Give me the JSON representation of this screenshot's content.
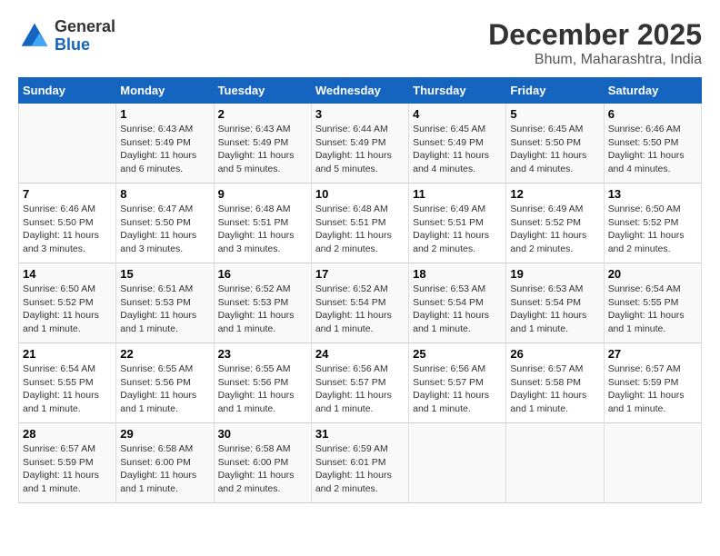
{
  "logo": {
    "line1": "General",
    "line2": "Blue"
  },
  "title": "December 2025",
  "location": "Bhum, Maharashtra, India",
  "days_header": [
    "Sunday",
    "Monday",
    "Tuesday",
    "Wednesday",
    "Thursday",
    "Friday",
    "Saturday"
  ],
  "weeks": [
    [
      {
        "day": "",
        "info": ""
      },
      {
        "day": "1",
        "info": "Sunrise: 6:43 AM\nSunset: 5:49 PM\nDaylight: 11 hours\nand 6 minutes."
      },
      {
        "day": "2",
        "info": "Sunrise: 6:43 AM\nSunset: 5:49 PM\nDaylight: 11 hours\nand 5 minutes."
      },
      {
        "day": "3",
        "info": "Sunrise: 6:44 AM\nSunset: 5:49 PM\nDaylight: 11 hours\nand 5 minutes."
      },
      {
        "day": "4",
        "info": "Sunrise: 6:45 AM\nSunset: 5:49 PM\nDaylight: 11 hours\nand 4 minutes."
      },
      {
        "day": "5",
        "info": "Sunrise: 6:45 AM\nSunset: 5:50 PM\nDaylight: 11 hours\nand 4 minutes."
      },
      {
        "day": "6",
        "info": "Sunrise: 6:46 AM\nSunset: 5:50 PM\nDaylight: 11 hours\nand 4 minutes."
      }
    ],
    [
      {
        "day": "7",
        "info": "Sunrise: 6:46 AM\nSunset: 5:50 PM\nDaylight: 11 hours\nand 3 minutes."
      },
      {
        "day": "8",
        "info": "Sunrise: 6:47 AM\nSunset: 5:50 PM\nDaylight: 11 hours\nand 3 minutes."
      },
      {
        "day": "9",
        "info": "Sunrise: 6:48 AM\nSunset: 5:51 PM\nDaylight: 11 hours\nand 3 minutes."
      },
      {
        "day": "10",
        "info": "Sunrise: 6:48 AM\nSunset: 5:51 PM\nDaylight: 11 hours\nand 2 minutes."
      },
      {
        "day": "11",
        "info": "Sunrise: 6:49 AM\nSunset: 5:51 PM\nDaylight: 11 hours\nand 2 minutes."
      },
      {
        "day": "12",
        "info": "Sunrise: 6:49 AM\nSunset: 5:52 PM\nDaylight: 11 hours\nand 2 minutes."
      },
      {
        "day": "13",
        "info": "Sunrise: 6:50 AM\nSunset: 5:52 PM\nDaylight: 11 hours\nand 2 minutes."
      }
    ],
    [
      {
        "day": "14",
        "info": "Sunrise: 6:50 AM\nSunset: 5:52 PM\nDaylight: 11 hours\nand 1 minute."
      },
      {
        "day": "15",
        "info": "Sunrise: 6:51 AM\nSunset: 5:53 PM\nDaylight: 11 hours\nand 1 minute."
      },
      {
        "day": "16",
        "info": "Sunrise: 6:52 AM\nSunset: 5:53 PM\nDaylight: 11 hours\nand 1 minute."
      },
      {
        "day": "17",
        "info": "Sunrise: 6:52 AM\nSunset: 5:54 PM\nDaylight: 11 hours\nand 1 minute."
      },
      {
        "day": "18",
        "info": "Sunrise: 6:53 AM\nSunset: 5:54 PM\nDaylight: 11 hours\nand 1 minute."
      },
      {
        "day": "19",
        "info": "Sunrise: 6:53 AM\nSunset: 5:54 PM\nDaylight: 11 hours\nand 1 minute."
      },
      {
        "day": "20",
        "info": "Sunrise: 6:54 AM\nSunset: 5:55 PM\nDaylight: 11 hours\nand 1 minute."
      }
    ],
    [
      {
        "day": "21",
        "info": "Sunrise: 6:54 AM\nSunset: 5:55 PM\nDaylight: 11 hours\nand 1 minute."
      },
      {
        "day": "22",
        "info": "Sunrise: 6:55 AM\nSunset: 5:56 PM\nDaylight: 11 hours\nand 1 minute."
      },
      {
        "day": "23",
        "info": "Sunrise: 6:55 AM\nSunset: 5:56 PM\nDaylight: 11 hours\nand 1 minute."
      },
      {
        "day": "24",
        "info": "Sunrise: 6:56 AM\nSunset: 5:57 PM\nDaylight: 11 hours\nand 1 minute."
      },
      {
        "day": "25",
        "info": "Sunrise: 6:56 AM\nSunset: 5:57 PM\nDaylight: 11 hours\nand 1 minute."
      },
      {
        "day": "26",
        "info": "Sunrise: 6:57 AM\nSunset: 5:58 PM\nDaylight: 11 hours\nand 1 minute."
      },
      {
        "day": "27",
        "info": "Sunrise: 6:57 AM\nSunset: 5:59 PM\nDaylight: 11 hours\nand 1 minute."
      }
    ],
    [
      {
        "day": "28",
        "info": "Sunrise: 6:57 AM\nSunset: 5:59 PM\nDaylight: 11 hours\nand 1 minute."
      },
      {
        "day": "29",
        "info": "Sunrise: 6:58 AM\nSunset: 6:00 PM\nDaylight: 11 hours\nand 1 minute."
      },
      {
        "day": "30",
        "info": "Sunrise: 6:58 AM\nSunset: 6:00 PM\nDaylight: 11 hours\nand 2 minutes."
      },
      {
        "day": "31",
        "info": "Sunrise: 6:59 AM\nSunset: 6:01 PM\nDaylight: 11 hours\nand 2 minutes."
      },
      {
        "day": "",
        "info": ""
      },
      {
        "day": "",
        "info": ""
      },
      {
        "day": "",
        "info": ""
      }
    ]
  ]
}
